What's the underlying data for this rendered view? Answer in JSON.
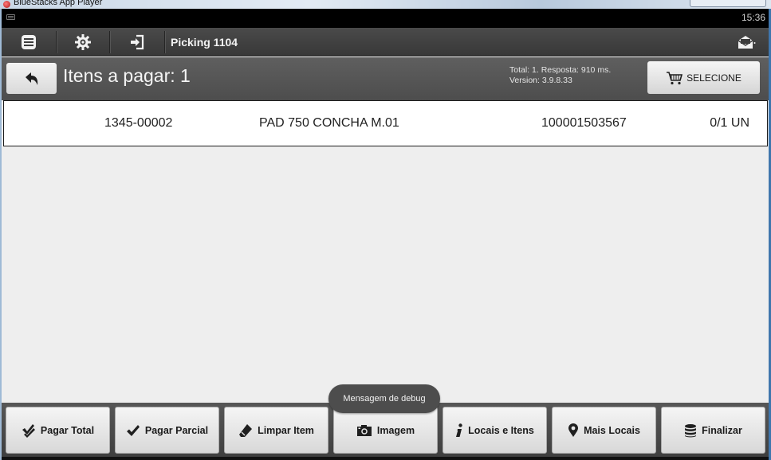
{
  "host": {
    "title": "BlueStacks App Player"
  },
  "status_bar": {
    "time": "15:36"
  },
  "action_bar": {
    "menu_icon": "list-icon",
    "settings_icon": "gear-icon",
    "logout_icon": "sign-in-icon",
    "title": "Picking 1104",
    "mail_icon": "mail-icon"
  },
  "sub_header": {
    "heading": "Itens a pagar: 1",
    "info_line1": "Total: 1. Resposta: 910 ms.",
    "info_line2": "Version: 3.9.8.33",
    "select_label": "SELECIONE"
  },
  "items": [
    {
      "code": "1345-00002",
      "description": "PAD 750 CONCHA M.01",
      "barcode": "100001503567",
      "quantity": "0/1 UN"
    }
  ],
  "toast": {
    "text": "Mensagem de debug"
  },
  "toolbar": {
    "buttons": [
      {
        "label": "Pagar Total",
        "icon": "double-check-icon"
      },
      {
        "label": "Pagar Parcial",
        "icon": "check-icon"
      },
      {
        "label": "Limpar Item",
        "icon": "eraser-icon"
      },
      {
        "label": "Imagem",
        "icon": "camera-icon"
      },
      {
        "label": "Locais e Itens",
        "icon": "info-icon"
      },
      {
        "label": "Mais Locais",
        "icon": "map-marker-icon"
      },
      {
        "label": "Finalizar",
        "icon": "database-icon"
      }
    ]
  },
  "colors": {
    "action_bar": "#404040",
    "sub_header": "#555555",
    "content_bg": "#eeeeee",
    "button_face": "#e6e6e6"
  }
}
